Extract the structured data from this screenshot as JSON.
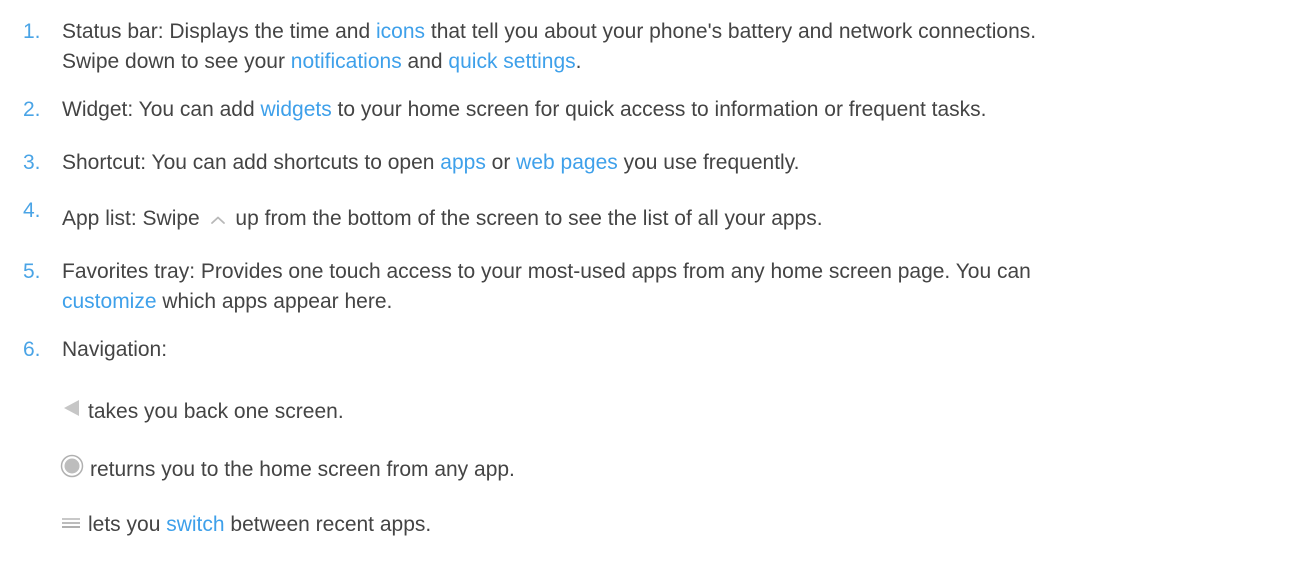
{
  "items": [
    {
      "num": "1.",
      "line1": {
        "a": "Status bar: Displays the time and ",
        "link1": "icons",
        "b": " that tell you about your phone's battery and network connections."
      },
      "line2": {
        "a": "Swipe down to see your ",
        "link1": "notifications",
        "b": " and ",
        "link2": "quick settings",
        "c": "."
      }
    },
    {
      "num": "2.",
      "a": "Widget: You can add ",
      "link1": "widgets",
      "b": " to your home screen for quick access to information or frequent tasks."
    },
    {
      "num": "3.",
      "a": "Shortcut: You can add shortcuts to open ",
      "link1": "apps",
      "b": " or ",
      "link2": "web pages",
      "c": " you use frequently."
    },
    {
      "num": "4.",
      "a": "App list: Swipe ",
      "icon": "chevron-up-icon",
      "b": " up from the bottom of the screen to see the list of all your apps."
    },
    {
      "num": "5.",
      "line1": "Favorites tray: Provides one touch access to your most-used apps from any home screen page. You can",
      "line2": {
        "link1": "customize",
        "b": " which apps appear here."
      }
    },
    {
      "num": "6.",
      "text": "Navigation:"
    }
  ],
  "navigation": {
    "back": {
      "icon": "back-triangle-icon",
      "text": "takes you back one screen."
    },
    "home": {
      "icon": "home-circle-icon",
      "text": "returns you to the home screen from any app."
    },
    "recents": {
      "icon": "recents-icon",
      "a": "lets you ",
      "link1": "switch",
      "b": " between recent apps."
    }
  },
  "colors": {
    "text": "#444444",
    "link": "#3ea0ea",
    "number": "#4aa4e6"
  }
}
